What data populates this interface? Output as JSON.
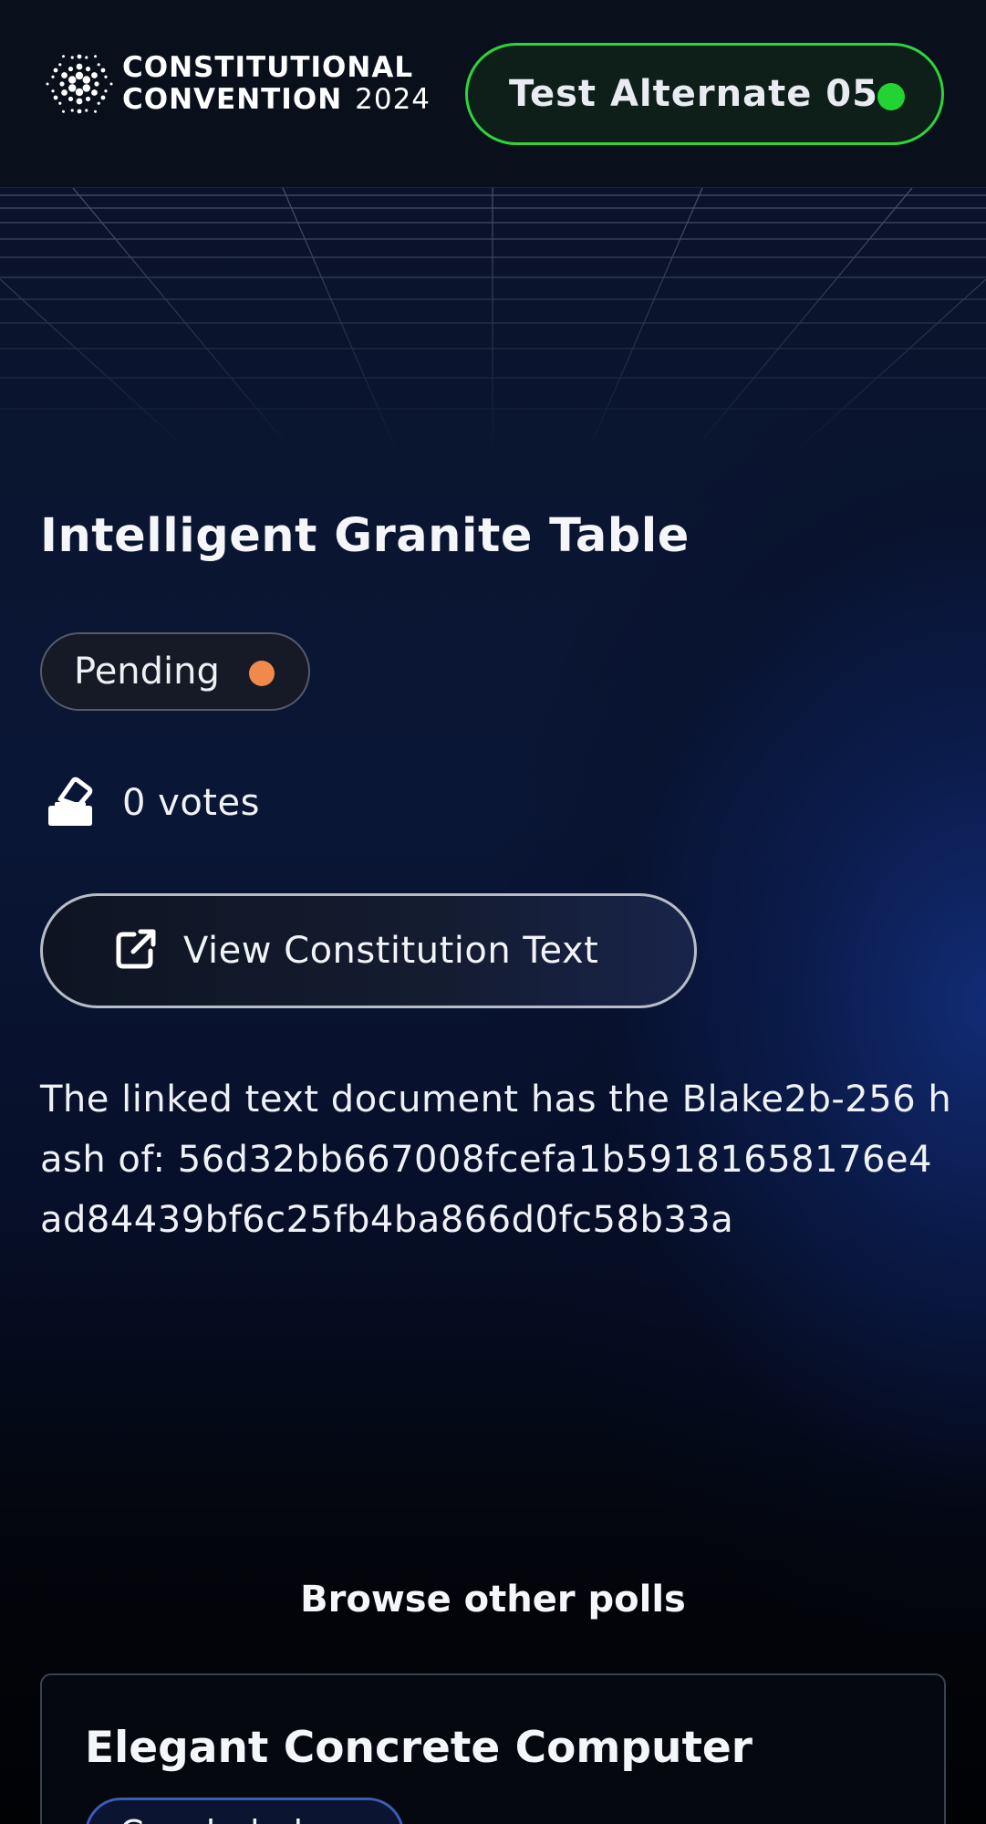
{
  "header": {
    "logo": {
      "line1": "CONSTITUTIONAL",
      "line2_bold": "CONVENTION",
      "line2_year": "2024"
    },
    "wallet": {
      "label": "Test Alternate 05",
      "status_color": "#22d433"
    }
  },
  "poll": {
    "title": "Intelligent Granite Table",
    "status": {
      "label": "Pending",
      "color": "#f0894a"
    },
    "votes_label": "0 votes",
    "votes_icon": "ballot-box-icon",
    "view_button": {
      "label": "View Constitution Text",
      "icon": "external-link-icon"
    },
    "hash_description": "The linked text document has the Blake2b-256 hash of: 56d32bb667008fcefa1b59181658176e4ad84439bf6c25fb4ba866d0fc58b33a"
  },
  "browse": {
    "title": "Browse other polls",
    "cards": [
      {
        "title": "Elegant Concrete Computer",
        "badge": "Concluded"
      }
    ]
  },
  "colors": {
    "accent_green": "#2ed43b",
    "pending_orange": "#f0894a",
    "background_dark": "#04070f",
    "background_blue": "#122d78"
  }
}
